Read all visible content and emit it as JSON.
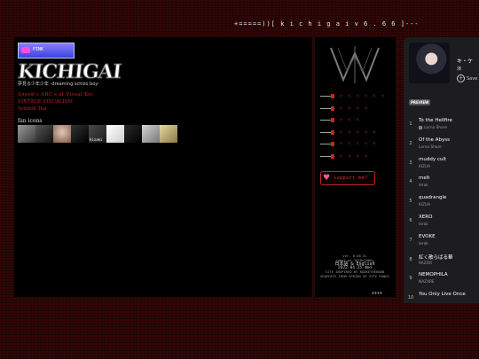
{
  "banner": {
    "title": "+=====))[ k i c h i g a i v 6 . 6 6 ]---"
  },
  "main": {
    "button_banner_text": "PINK",
    "logo_text": "KICHIGAI",
    "logo_subtitle": "夢見る少年少年 -dreaming schizo boy-",
    "links": [
      "Snoob's ABC's of Visual Kei",
      "VINTAGE VISUALISM",
      "Symbol Tea"
    ],
    "fan_icons_label": "fan icons",
    "fan_icons": [
      {
        "name": "",
        "caption": "",
        "color": "#6f6f6f"
      },
      {
        "name": "",
        "caption": "",
        "color": "#3b3b2b"
      },
      {
        "name": "",
        "caption": "",
        "color": "#c6a89a"
      },
      {
        "name": "",
        "caption": "",
        "color": "#1e1e1e"
      },
      {
        "name": "",
        "caption": "hizaki",
        "color": "#2b2b2b"
      },
      {
        "name": "",
        "caption": "",
        "color": "#e9e9e9"
      },
      {
        "name": "",
        "caption": "",
        "color": "#1e1e1e"
      },
      {
        "name": "",
        "caption": "",
        "color": "#bdbdbd"
      },
      {
        "name": "",
        "caption": "",
        "color": "#d8cba0"
      }
    ],
    "fan_icons_top_label": "fan icons"
  },
  "side": {
    "menu": [
      {
        "label": "u u u u u u"
      },
      {
        "label": "u u u u"
      },
      {
        "label": "u u u"
      },
      {
        "label": "u u u u u"
      },
      {
        "label": "u u u u u"
      },
      {
        "label": "u u u u"
      }
    ],
    "support_label": "support me?",
    "footer_lines": [
      "ver. 6.66.5i",
      "ideal at 1920x1080+"
    ],
    "footer_date": "2022.04.25 dmd",
    "footer_lang": "日本語 & English",
    "footer_credits": [
      "SITE INSPIRED BY KOOKETHEKNOB",
      "GRAPHICS FROM SPRING OF SITE RANKS"
    ],
    "footer_badge": "⚜⚜⚜⚜"
  },
  "player": {
    "album_title": "キ・ケ",
    "album_sub": "演",
    "save_label": "Save",
    "preview_label": "PREVIEW",
    "tracks": [
      {
        "num": "1",
        "title": "To the Hellfire",
        "artist": "Lorna Shore",
        "explicit": true
      },
      {
        "num": "2",
        "title": "Of the Abyss",
        "artist": "Lorna Shore",
        "explicit": false
      },
      {
        "num": "3",
        "title": "muddy cult",
        "artist": "KIZUA",
        "explicit": false
      },
      {
        "num": "4",
        "title": "melt",
        "artist": "lerak",
        "explicit": false
      },
      {
        "num": "5",
        "title": "quadrangle",
        "artist": "KIZUA",
        "explicit": false
      },
      {
        "num": "6",
        "title": "XERO",
        "artist": "lerak",
        "explicit": false
      },
      {
        "num": "7",
        "title": "EVOKE",
        "artist": "lerak",
        "explicit": false
      },
      {
        "num": "8",
        "title": "紅く散らばる華",
        "artist": "RAZOR",
        "explicit": false
      },
      {
        "num": "9",
        "title": "NEMOPHILA",
        "artist": "NAZARE",
        "explicit": false
      },
      {
        "num": "10",
        "title": "You Only Live Once",
        "artist": "",
        "explicit": false
      }
    ]
  }
}
